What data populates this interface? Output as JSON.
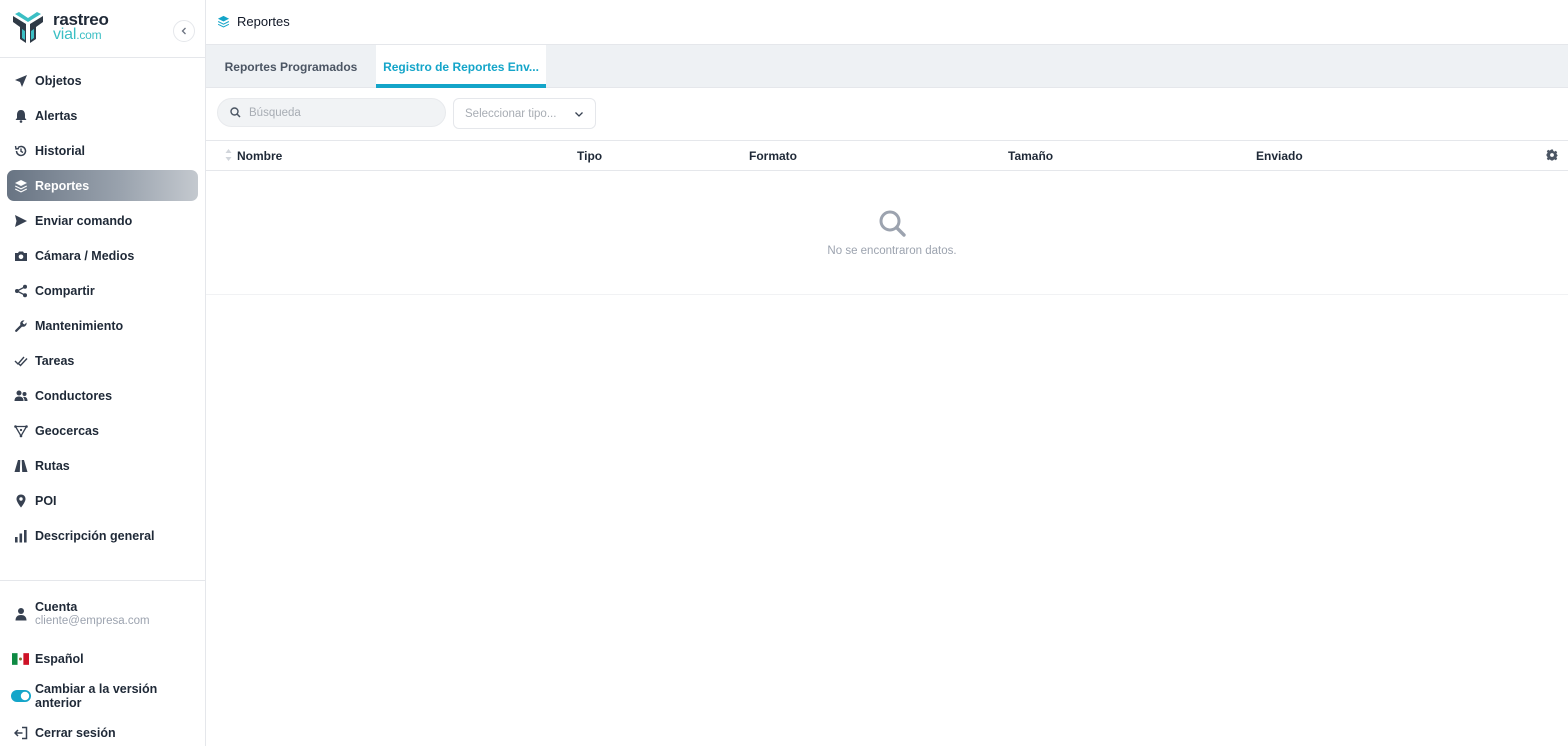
{
  "brand": {
    "line1": "rastreo",
    "line2_main": "vial",
    "line2_suffix": ".com",
    "accent": "#14a5c9"
  },
  "sidebar": {
    "items": [
      {
        "label": "Objetos",
        "icon": "navigation-arrow-icon"
      },
      {
        "label": "Alertas",
        "icon": "bell-icon"
      },
      {
        "label": "Historial",
        "icon": "history-icon"
      },
      {
        "label": "Reportes",
        "icon": "layers-icon",
        "active": true
      },
      {
        "label": "Enviar comando",
        "icon": "send-icon"
      },
      {
        "label": "Cámara / Medios",
        "icon": "camera-icon"
      },
      {
        "label": "Compartir",
        "icon": "share-icon"
      },
      {
        "label": "Mantenimiento",
        "icon": "wrench-icon"
      },
      {
        "label": "Tareas",
        "icon": "double-check-icon"
      },
      {
        "label": "Conductores",
        "icon": "users-icon"
      },
      {
        "label": "Geocercas",
        "icon": "polygon-icon"
      },
      {
        "label": "Rutas",
        "icon": "road-icon"
      },
      {
        "label": "POI",
        "icon": "map-pin-icon"
      },
      {
        "label": "Descripción general",
        "icon": "bar-chart-icon"
      }
    ],
    "footer": {
      "account_label": "Cuenta",
      "account_email": "cliente@empresa.com",
      "language": "Español",
      "legacy_toggle": "Cambiar a la versión anterior",
      "logout": "Cerrar sesión"
    }
  },
  "header": {
    "title": "Reportes"
  },
  "tabs": [
    {
      "label": "Reportes Programados",
      "active": false
    },
    {
      "label": "Registro de Reportes Env...",
      "active": true
    }
  ],
  "filters": {
    "search_placeholder": "Búsqueda",
    "type_placeholder": "Seleccionar tipo..."
  },
  "table": {
    "columns": [
      "Nombre",
      "Tipo",
      "Formato",
      "Tamaño",
      "Enviado"
    ],
    "empty_message": "No se encontraron datos."
  }
}
